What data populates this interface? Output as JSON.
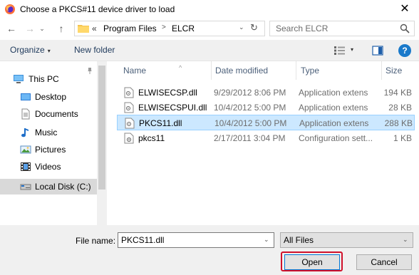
{
  "window": {
    "title": "Choose a PKCS#11 device driver to load",
    "close_glyph": "✕",
    "icon": "firefox-icon"
  },
  "navigation": {
    "back_glyph": "←",
    "forward_glyph": "→",
    "recent_glyph": "⌄",
    "up_glyph": "↑",
    "breadcrumb_overflow": "«",
    "breadcrumb": [
      "Program Files",
      "ELCR"
    ],
    "breadcrumb_separator": ">",
    "dropdown_glyph": "⌄",
    "refresh_glyph": "↻",
    "search_placeholder": "Search ELCR"
  },
  "toolbar": {
    "organize_label": "Organize",
    "organize_caret": "▾",
    "new_folder_label": "New folder",
    "view_caret": "▾",
    "help_glyph": "?"
  },
  "sidebar": {
    "pin_glyph": "📌",
    "items": [
      {
        "label": "This PC",
        "icon": "pc-icon"
      },
      {
        "label": "Desktop",
        "icon": "desktop-folder-icon"
      },
      {
        "label": "Documents",
        "icon": "documents-folder-icon"
      },
      {
        "label": "Music",
        "icon": "music-icon"
      },
      {
        "label": "Pictures",
        "icon": "pictures-folder-icon"
      },
      {
        "label": "Videos",
        "icon": "videos-folder-icon"
      },
      {
        "label": "Local Disk (C:)",
        "icon": "drive-icon"
      }
    ],
    "scroll_position": 0.0
  },
  "file_list": {
    "columns": [
      "Name",
      "Date modified",
      "Type",
      "Size"
    ],
    "sort_glyph": "^",
    "rows": [
      {
        "name": "ELWISECSP.dll",
        "date": "9/29/2012 8:06 PM",
        "type": "Application extens",
        "size": "194 KB",
        "selected": false
      },
      {
        "name": "ELWISECSPUI.dll",
        "date": "10/4/2012 5:00 PM",
        "type": "Application extens",
        "size": "28 KB",
        "selected": false
      },
      {
        "name": "PKCS11.dll",
        "date": "10/4/2012 5:00 PM",
        "type": "Application extens",
        "size": "288 KB",
        "selected": true
      },
      {
        "name": "pkcs11",
        "date": "2/17/2011 3:04 PM",
        "type": "Configuration sett...",
        "size": "1 KB",
        "selected": false
      }
    ]
  },
  "footer": {
    "file_name_label": "File name:",
    "file_name_value": "PKCS11.dll",
    "file_type_value": "All Files",
    "dropdown_glyph": "⌄",
    "open_label": "Open",
    "cancel_label": "Cancel"
  },
  "colors": {
    "selection_bg": "#cce8ff",
    "selection_border": "#99d1ff",
    "highlight_ring": "#d0112b",
    "link_text": "#1e395b"
  }
}
